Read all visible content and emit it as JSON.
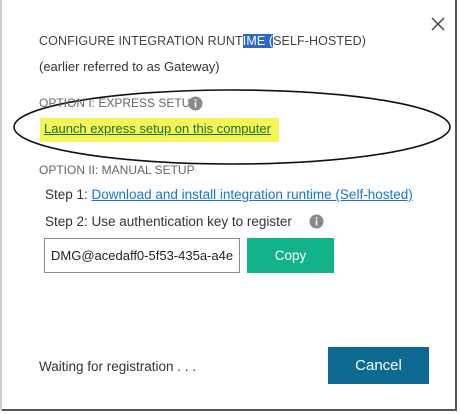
{
  "dialog": {
    "title_before": "CONFIGURE INTEGRATION RUNT",
    "title_highlight": "IME (",
    "title_after": "SELF-HOSTED)",
    "subtitle": "(earlier referred to as Gateway)",
    "close_icon": "close-icon"
  },
  "option1": {
    "heading": "OPTION I: EXPRESS SETUP",
    "info_icon": "info-icon",
    "express_link": "Launch express setup on this computer",
    "highlight_color": "#f5f55a"
  },
  "option2": {
    "heading": "OPTION II: MANUAL SETUP",
    "step1_label": "Step 1: ",
    "step1_link": "Download and install integration runtime (Self-hosted)",
    "step2_label": "Step 2: Use authentication key to register",
    "info_icon": "info-icon",
    "auth_key_value": "DMG@acedaff0-5f53-435a-a4e",
    "copy_label": "Copy"
  },
  "footer": {
    "status": "Waiting for registration . . .",
    "cancel_label": "Cancel"
  },
  "colors": {
    "copy_button": "#13b38a",
    "cancel_button": "#0e6a93",
    "link": "#1a75c9",
    "title_selection": "#2f68c4"
  }
}
